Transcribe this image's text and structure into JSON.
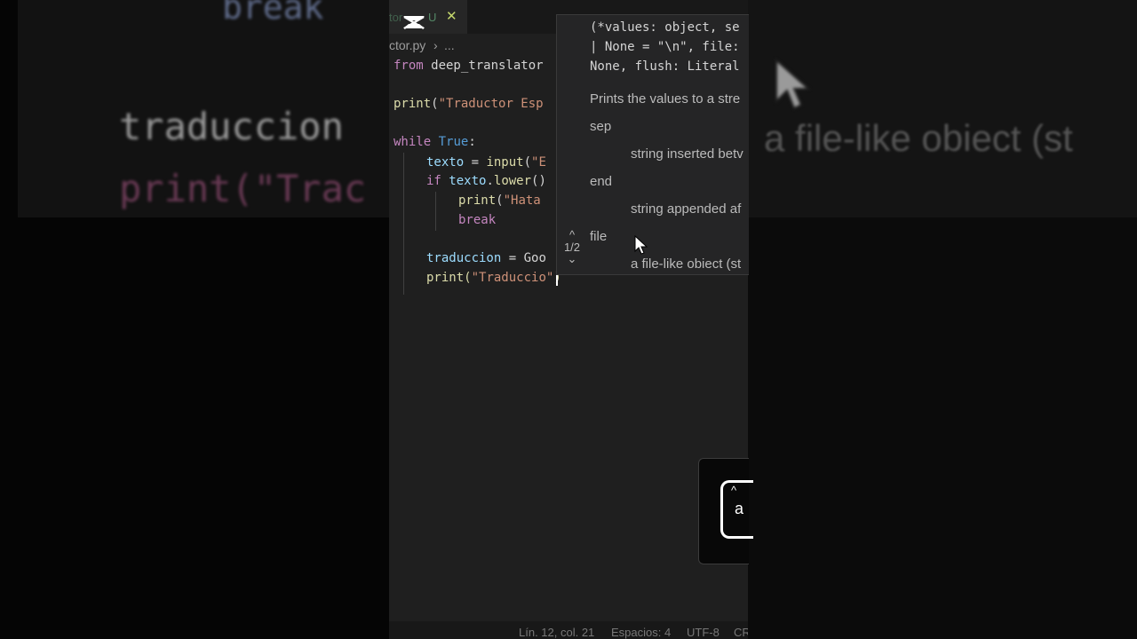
{
  "background": {
    "left_lines": [
      "break",
      "traduccion",
      "print(\"Trac"
    ],
    "right_text": "a file-like obiect (st"
  },
  "editor": {
    "tab": {
      "name": "tor",
      "status": "U",
      "close": "✕"
    },
    "breadcrumb": {
      "file": "ctor.py",
      "sep": "›",
      "more": "..."
    },
    "code": {
      "l1": {
        "kw": "from",
        "rest": " deep_translator"
      },
      "l3": {
        "fn": "print",
        "p1": "(",
        "str": "\"Traductor Esp"
      },
      "l5": {
        "kw": "while",
        "sp": " ",
        "val": "True",
        "colon": ":"
      },
      "l6": {
        "id": "texto",
        "eq": " = ",
        "fn": "input",
        "p1": "(",
        "str": "\"E"
      },
      "l7": {
        "kw": "if",
        "sp": " ",
        "id": "texto",
        "dot": ".",
        "fn": "lower",
        "p": "()"
      },
      "l8": {
        "fn": "print",
        "p1": "(",
        "str": "\"Hata"
      },
      "l9": {
        "kw": "break"
      },
      "l11": {
        "id": "traduccion",
        "eq": " = ",
        "rest": "Goo"
      },
      "l12": {
        "fn": "print",
        "p1": "(",
        "str": "\"Traduccio\"",
        "p2": ")"
      }
    },
    "hover": {
      "signature": [
        "(*values: object, se",
        "| None = \"\\n\", file:",
        "None, flush: Literal"
      ],
      "description": "Prints the values to a stre",
      "params": [
        {
          "name": "sep",
          "desc": "string inserted betv"
        },
        {
          "name": "end",
          "desc": "string appended af"
        },
        {
          "name": "file",
          "desc": "a file-like obiect (st"
        }
      ],
      "page": "1/2",
      "up_icon": "^",
      "down_icon": "⌄"
    },
    "status": {
      "position": "Lín. 12, col. 21",
      "spaces": "Espacios: 4",
      "encoding": "UTF-8",
      "eol": "CR"
    }
  },
  "overlay": {
    "key_label": "a",
    "arrow": "^"
  }
}
